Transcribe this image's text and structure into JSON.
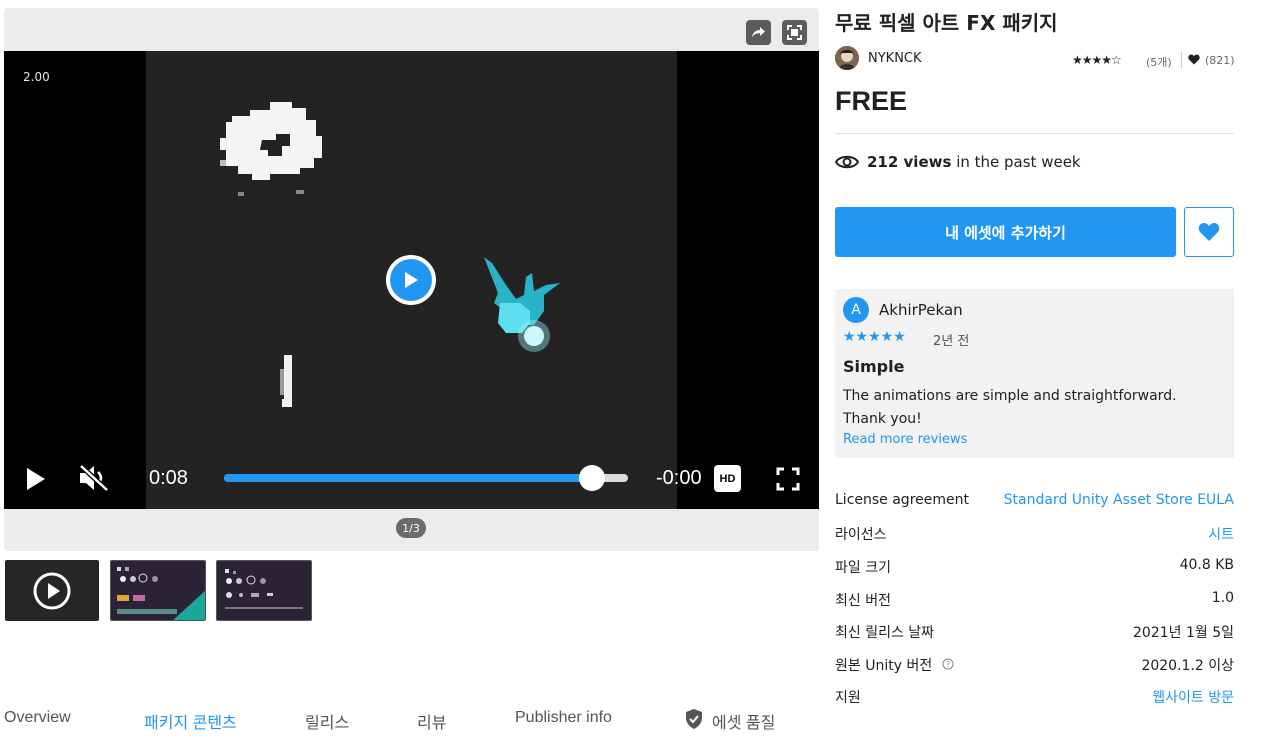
{
  "media": {
    "speed_label": "2.00",
    "current_time": "0:08",
    "remaining_time": "-0:00",
    "hd_label": "HD",
    "progress": 0.91,
    "pager": "1/3"
  },
  "tabs": [
    {
      "label": "Overview"
    },
    {
      "label": "패키지 콘텐츠"
    },
    {
      "label": "릴리스"
    },
    {
      "label": "리뷰"
    },
    {
      "label": "Publisher info"
    },
    {
      "label": "에셋 품질"
    }
  ],
  "product": {
    "title": "무료 픽셀 아트 FX 패키지",
    "publisher": "NYKNCK",
    "rating_stars": "★★★★☆",
    "rating_count": "(5개)",
    "favorites": "(821)",
    "price": "FREE",
    "views_count": "212 views",
    "views_suffix": " in the past week",
    "add_button": "내 에셋에 추가하기"
  },
  "review": {
    "initial": "A",
    "author": "AkhirPekan",
    "stars": "★★★★★",
    "date": "2년 전",
    "title": "Simple",
    "body": "The animations are simple and straightforward. Thank you!",
    "more_link": "Read more reviews"
  },
  "info": [
    {
      "label": "License agreement",
      "value": "Standard Unity Asset Store EULA",
      "link": true
    },
    {
      "label": "라이선스",
      "value": "시트",
      "link": true
    },
    {
      "label": "파일 크기",
      "value": "40.8 KB",
      "link": false
    },
    {
      "label": "최신 버전",
      "value": "1.0",
      "link": false
    },
    {
      "label": "최신 릴리스 날짜",
      "value": "2021년 1월 5일",
      "link": false
    },
    {
      "label": "원본 Unity 버전",
      "value": "2020.1.2 이상",
      "link": false
    },
    {
      "label": "지원",
      "value": "웹사이트 방문",
      "link": true
    }
  ],
  "colors": {
    "accent": "#2196f3"
  }
}
